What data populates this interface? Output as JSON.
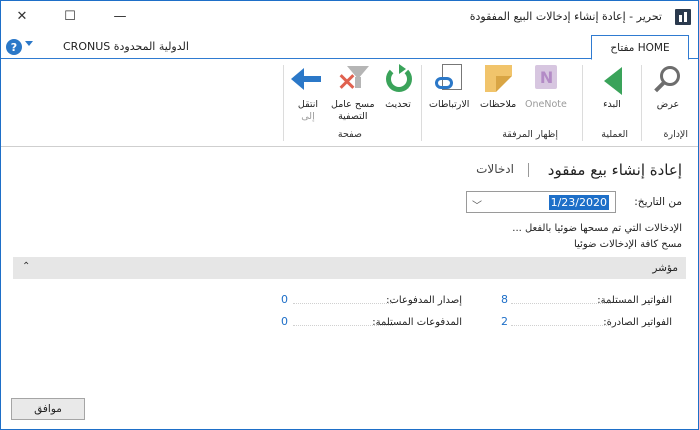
{
  "window": {
    "title": "تحرير - إعادة إنشاء إدخالات البيع المفقودة",
    "controls": {
      "close": "✕",
      "maximize": "☐",
      "minimize": "—"
    }
  },
  "tabbar": {
    "company": "CRONUS الدولية المحدودة",
    "home_tab": "مفتاح HOME",
    "help": "?"
  },
  "ribbon": {
    "buttons": [
      {
        "label": "عرض",
        "icon": "magnifier-icon"
      },
      {
        "label": "البدء",
        "icon": "play-icon"
      },
      {
        "label": "OneNote",
        "icon": "onenote-icon"
      },
      {
        "label": "ملاحظات",
        "icon": "note-icon"
      },
      {
        "label": "الارتباطات",
        "icon": "links-icon"
      },
      {
        "label": "تحديث",
        "icon": "refresh-icon"
      },
      {
        "label": "مسح عامل",
        "label2": "التصفية",
        "icon": "clear-filter-icon"
      },
      {
        "label": "انتقل",
        "label2": "إلى",
        "icon": "arrow-left-icon"
      }
    ],
    "groups": {
      "manage": "الإدارة",
      "process": "العملية",
      "show_attached": "إظهار المرفقة",
      "page": "صفحة"
    }
  },
  "content": {
    "title": "إعادة إنشاء بيع مفقود",
    "subtitle": "ادخالات",
    "date_label": "من التاريخ:",
    "date_value": "1/23/2020",
    "info_line1": "الإدخالات التي تم مسحها ضوئيا بالفعل ...",
    "info_line2": "مسح كافة الإدخالات ضوئيا"
  },
  "indicators": {
    "section_title": "مؤشر",
    "rows": [
      {
        "label": "الفواتير المستلمة:",
        "value": "8"
      },
      {
        "label": "إصدار المدفوعات:",
        "value": "0"
      },
      {
        "label": "الفواتير الصادرة:",
        "value": "2"
      },
      {
        "label": "المدفوعات المستلمة:",
        "value": "0"
      }
    ]
  },
  "footer": {
    "ok": "موافق"
  },
  "colors": {
    "accent": "#1e6fc8",
    "green": "#3aa35a",
    "section_bg": "#e6e6e6"
  }
}
